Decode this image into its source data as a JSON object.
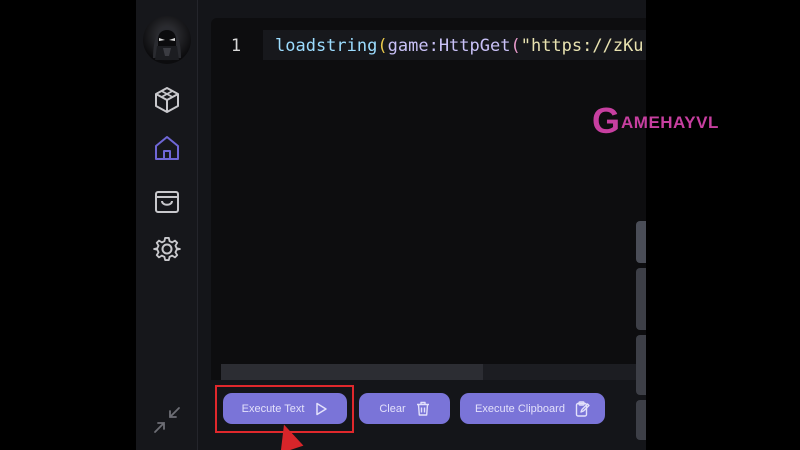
{
  "editor": {
    "line_number": "1",
    "code": {
      "fn": "loadstring",
      "paren_open": "(",
      "object": "game",
      "colon": ":",
      "method": "HttpGet",
      "paren_open_2": "(",
      "string": "\"https://zKu"
    }
  },
  "toolbar": {
    "execute_label": "Execute Text",
    "clear_label": "Clear",
    "clipboard_label": "Execute Clipboard"
  },
  "sidebar": {
    "items": [
      {
        "icon": "cube-icon"
      },
      {
        "icon": "home-icon",
        "active": true
      },
      {
        "icon": "shopping-bag-icon"
      },
      {
        "icon": "gear-icon"
      }
    ]
  },
  "watermark": {
    "brand_initial": "G",
    "brand_rest": "AMEHAYVL"
  },
  "colors": {
    "accent": "#7a74d8",
    "active_icon": "#6f67d6",
    "highlight": "#e0282c",
    "watermark": "#c73fa0"
  }
}
